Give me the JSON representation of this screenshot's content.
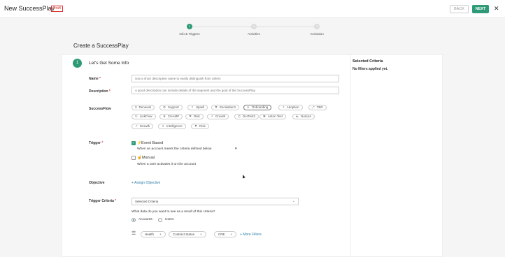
{
  "header": {
    "title": "New SuccessPlay",
    "badge": "Draft",
    "back_label": "BACK",
    "next_label": "NEXT",
    "close_glyph": "✕"
  },
  "stepper": {
    "steps": [
      {
        "number": "1",
        "label": "Info & Triggers",
        "active": true
      },
      {
        "number": "2",
        "label": "Activities",
        "active": false
      },
      {
        "number": "3",
        "label": "Activation",
        "active": false
      }
    ]
  },
  "page_title": "Create a SuccessPlay",
  "section": {
    "number": "1",
    "title": "Let's Get Some Info"
  },
  "form": {
    "name_label": "Name",
    "name_placeholder": "Use a short descriptive name to easily distinguish from others",
    "description_label": "Description",
    "description_placeholder": "A good description can include details of the segment and the goal of the SuccessPlay",
    "successflow_label": "SuccessFlow",
    "successflow_chips": [
      {
        "label": "Renewal",
        "icon": "$",
        "selected": false
      },
      {
        "label": "Support",
        "icon": "⚙",
        "selected": false
      },
      {
        "label": "Upsell",
        "icon": "⇧",
        "selected": false
      },
      {
        "label": "Escalation1",
        "icon": "⚑",
        "selected": false
      },
      {
        "label": "Onboarding",
        "icon": "✈",
        "selected": true
      },
      {
        "label": "Adoption",
        "icon": "↗",
        "selected": false
      },
      {
        "label": "TBD",
        "icon": "⤢",
        "selected": false
      },
      {
        "label": "LinkFlow",
        "icon": "↻",
        "selected": false
      },
      {
        "label": "CHAMP",
        "icon": "♛",
        "selected": false
      },
      {
        "label": "Risk",
        "icon": "⚑",
        "selected": false
      },
      {
        "label": "Growth",
        "icon": "↗",
        "selected": false
      },
      {
        "label": "DorTest2",
        "icon": "⌬",
        "selected": false
      },
      {
        "label": "Anton Test",
        "icon": "✱",
        "selected": false
      },
      {
        "label": "Nurture",
        "icon": "☯",
        "selected": false
      },
      {
        "label": "Growth",
        "icon": "↗",
        "selected": false
      },
      {
        "label": "Intelligence",
        "icon": "☀",
        "selected": false
      },
      {
        "label": "Risk",
        "icon": "⚑",
        "selected": false
      }
    ],
    "trigger_label": "Trigger",
    "trigger_event_label": "Event Based",
    "trigger_event_sub": "When an account meets the criteria defined below",
    "trigger_manual_label": "Manual",
    "trigger_manual_sub": "When a user activates it on the account",
    "objective_label": "Objective",
    "assign_objective": "+ Assign Objective",
    "criteria_label": "Trigger Criteria",
    "criteria_value": "Selected Criteria",
    "criteria_question": "What data do you want to see as a result of this criteria?",
    "radio_accounts": "Accounts",
    "radio_users": "Users",
    "filters": [
      "Health",
      "Contract Status",
      "CRE"
    ],
    "more_filters": "+ More Filters"
  },
  "right_panel": {
    "title": "Selected Criteria",
    "empty_text": "No filters applied yet."
  },
  "colors": {
    "accent": "#2e9a77",
    "link": "#2e7fa8",
    "required": "#dd3333"
  }
}
